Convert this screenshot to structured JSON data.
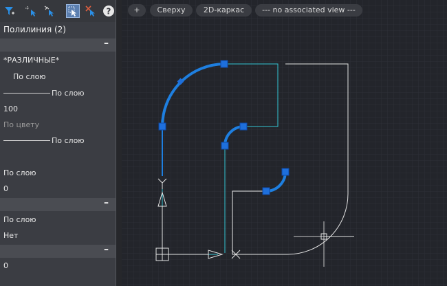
{
  "viewport_labels": {
    "plus": "+",
    "view": "Сверху",
    "visual_style": "2D-каркас",
    "named_view": "--- no associated view ---"
  },
  "properties": {
    "title": "Полилиния (2)",
    "collapse_symbol": "–",
    "general": {
      "color": "*РАЗЛИЧНЫЕ*",
      "layer": "По слою",
      "linetype": "По слою",
      "linetype_scale": "100",
      "plot_style": "По цвету",
      "lineweight": "По слою",
      "hyperlink": "",
      "thickness_label": "По слою",
      "thickness": "0"
    },
    "section2": {
      "material": "По слою",
      "shadow": "Нет"
    },
    "section3": {
      "value": "0"
    }
  },
  "colors": {
    "viewport_bg": "#23252b",
    "selected_polyline": "#1e7fe0",
    "grip": "#1e6fdc",
    "cyan_line": "#33c6d6",
    "white_line": "#e6e6e6"
  },
  "icons": [
    "filter-icon",
    "select-add-icon",
    "select-quick-icon",
    "pick-objects-icon",
    "toggle-pickadd-icon",
    "help-icon"
  ]
}
